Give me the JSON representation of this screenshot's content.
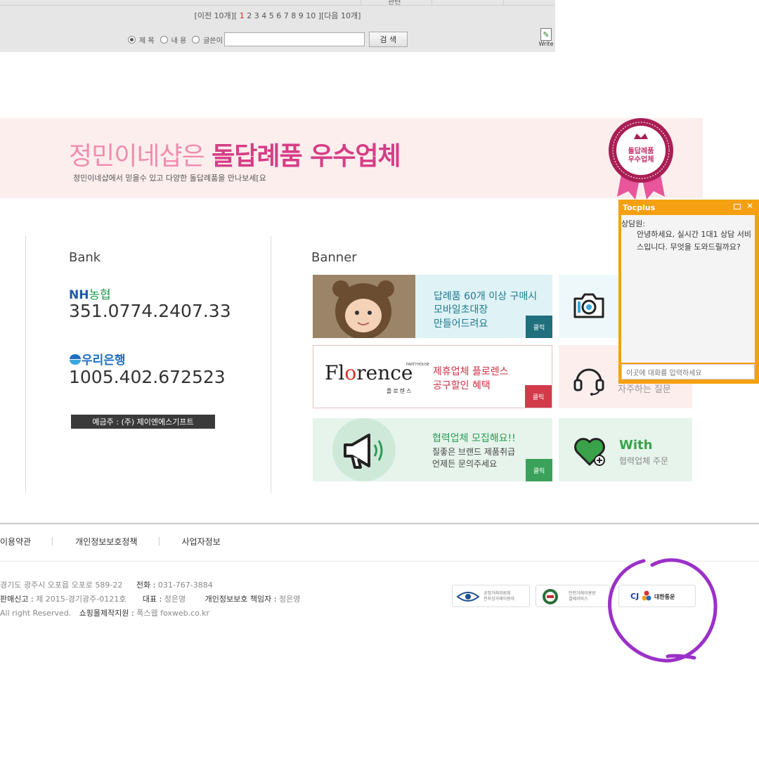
{
  "board": {
    "top_cut_text": "관련",
    "pager_prefix": "[이전 10개][ ",
    "pager_current": "1",
    "pager_pages": " 2 3 4 5 6 7 8 9 10 ][다음 10개]",
    "search_options": [
      "제 목",
      "내 용",
      "글쓴이"
    ],
    "search_selected": "제 목",
    "search_value": "",
    "search_button": "검 색",
    "write_label": "Write"
  },
  "promo": {
    "title_light": "정민이네샵은 ",
    "title_bold": "돌답례품 우수업체",
    "subtitle": "정민이네샵에서 믿을수 있고 다양한 돌답례품을 만나보세[요",
    "seal_line1": "돌답례품",
    "seal_line2": "우수업체"
  },
  "bank": {
    "heading": "Bank",
    "nh_logo_a": "NH",
    "nh_logo_b": "농협",
    "nh_account": "351.0774.2407.33",
    "woori_logo": "우리은행",
    "woori_account": "1005.402.672523",
    "holder": "예금주 : (주) 제이엔에스기프트"
  },
  "banners": {
    "heading": "Banner",
    "click_label": "클릭",
    "b1_line1": "답례품 60개 이상 구매시",
    "b1_line2": "모바일초대장",
    "b1_line3": "만들어드려요",
    "b2_logo_pre": "Fl",
    "b2_logo_o": "o",
    "b2_logo_post": "rence",
    "b2_logo_small": "PARTYHOUSE",
    "b2_logo_kr": "플로렌스",
    "b2_line1": "제휴업체 플로렌스",
    "b2_line2": "공구할인 혜택",
    "b3_line1": "협력업체 모집해요!!",
    "b3_line2": "질좋은 브랜드 제품취급",
    "b3_line3": "언제든 문의주세요",
    "s2_text": "자주하는 질문",
    "s3_title": "With",
    "s3_sub": "협력업체 주문"
  },
  "chat": {
    "title": "Tocplus",
    "who": "상담원:",
    "message": "안녕하세요, 실시간 1대1 상담 서비스입니다. 무엇을 도와드릴까요?",
    "input_placeholder": "이곳에 대화를 입력하세요"
  },
  "footer": {
    "links": [
      "이용약관",
      "개인정보보호정책",
      "사업자정보"
    ],
    "addr": "경기도 광주시 오포읍 오포로 589-22",
    "phone_label": "전화 : ",
    "phone": "031-767-3884",
    "mail_order_label": "판매신고 : ",
    "mail_order": "제 2015-경기광주-0121호",
    "ceo_label": "대표 : ",
    "ceo": "정은영",
    "privacy_label": "개인정보보호 책임자 : ",
    "privacy": "정은영",
    "rights": "All right Reserved.",
    "maker_label": "쇼핑몰제작지원 : ",
    "maker": "폭스웹 foxweb.co.kr",
    "cert1_line1": "공정거래위원회",
    "cert1_line2": "전자상거래이용자",
    "cert2_line1": "안전거래이용방",
    "cert2_line2": "결제서비스",
    "cert3_brand": "CJ",
    "cert3_name": "대한통운"
  },
  "colors": {
    "accent_pink": "#d63e86",
    "chat_orange": "#f5a010",
    "annotation_purple": "#9b30c8"
  }
}
